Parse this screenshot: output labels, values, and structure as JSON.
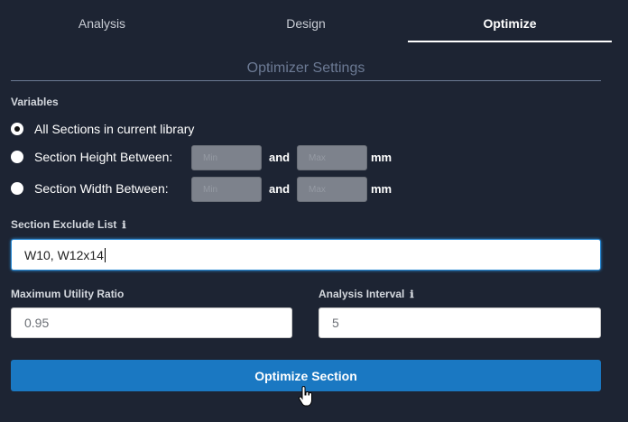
{
  "tabs": [
    {
      "label": "Analysis"
    },
    {
      "label": "Design"
    },
    {
      "label": "Optimize",
      "active": true
    }
  ],
  "section_title": "Optimizer Settings",
  "variables": {
    "label": "Variables",
    "options": [
      {
        "label": "All Sections in current library",
        "checked": true
      },
      {
        "label": "Section Height Between:"
      },
      {
        "label": "Section Width Between:"
      }
    ],
    "min_placeholder": "Min",
    "max_placeholder": "Max",
    "and": "and",
    "unit": "mm"
  },
  "exclude": {
    "label": "Section Exclude List",
    "value": "W10, W12x14"
  },
  "utility": {
    "label": "Maximum Utility Ratio",
    "value": "0.95"
  },
  "interval": {
    "label": "Analysis Interval",
    "value": "5"
  },
  "optimize_button": "Optimize Section",
  "info_icon": "ℹ"
}
